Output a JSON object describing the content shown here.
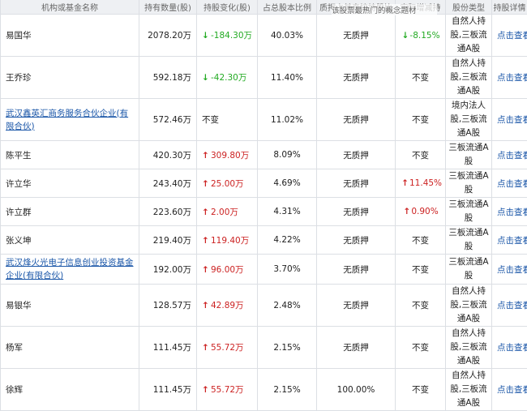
{
  "header": [
    "机构或基金名称",
    "持有数量(股)",
    "持股变化(股)",
    "占总股本比例",
    "质押占其直接持股比",
    "实际增减持",
    "股份类型",
    "持股详情"
  ],
  "tooltip": "该股票最热门的概念题材",
  "rows": [
    {
      "name": "易国华",
      "link": false,
      "qty": "2078.20万",
      "change": "-184.30万",
      "dir": "down",
      "ratio": "40.03%",
      "pledge": "无质押",
      "actual": "-8.15%",
      "actual_dir": "down",
      "type": "自然人持股,三板流通A股",
      "detail": "点击查看"
    },
    {
      "name": "王乔珍",
      "link": false,
      "qty": "592.18万",
      "change": "-42.30万",
      "dir": "down",
      "ratio": "11.40%",
      "pledge": "无质押",
      "actual": "不变",
      "actual_dir": "",
      "type": "自然人持股,三板流通A股",
      "detail": "点击查看"
    },
    {
      "name": "武汉鑫英汇商务服务合伙企业(有限合伙)",
      "link": true,
      "qty": "572.46万",
      "change": "不变",
      "dir": "",
      "ratio": "11.02%",
      "pledge": "无质押",
      "actual": "不变",
      "actual_dir": "",
      "type": "境内法人股,三板流通A股",
      "detail": "点击查看"
    },
    {
      "name": "陈平生",
      "link": false,
      "qty": "420.30万",
      "change": "309.80万",
      "dir": "up",
      "ratio": "8.09%",
      "pledge": "无质押",
      "actual": "不变",
      "actual_dir": "",
      "type": "三板流通A股",
      "detail": "点击查看"
    },
    {
      "name": "许立华",
      "link": false,
      "qty": "243.40万",
      "change": "25.00万",
      "dir": "up",
      "ratio": "4.69%",
      "pledge": "无质押",
      "actual": "11.45%",
      "actual_dir": "up",
      "type": "三板流通A股",
      "detail": "点击查看"
    },
    {
      "name": "许立群",
      "link": false,
      "qty": "223.60万",
      "change": "2.00万",
      "dir": "up",
      "ratio": "4.31%",
      "pledge": "无质押",
      "actual": "0.90%",
      "actual_dir": "up",
      "type": "三板流通A股",
      "detail": "点击查看"
    },
    {
      "name": "张义坤",
      "link": false,
      "qty": "219.40万",
      "change": "119.40万",
      "dir": "up",
      "ratio": "4.22%",
      "pledge": "无质押",
      "actual": "不变",
      "actual_dir": "",
      "type": "三板流通A股",
      "detail": "点击查看"
    },
    {
      "name": "武汉烽火光电子信息创业投资基金企业(有限合伙)",
      "link": true,
      "qty": "192.00万",
      "change": "96.00万",
      "dir": "up",
      "ratio": "3.70%",
      "pledge": "无质押",
      "actual": "不变",
      "actual_dir": "",
      "type": "三板流通A股",
      "detail": "点击查看"
    },
    {
      "name": "易银华",
      "link": false,
      "qty": "128.57万",
      "change": "42.89万",
      "dir": "up",
      "ratio": "2.48%",
      "pledge": "无质押",
      "actual": "不变",
      "actual_dir": "",
      "type": "自然人持股,三板流通A股",
      "detail": "点击查看"
    },
    {
      "name": "杨军",
      "link": false,
      "qty": "111.45万",
      "change": "55.72万",
      "dir": "up",
      "ratio": "2.15%",
      "pledge": "无质押",
      "actual": "不变",
      "actual_dir": "",
      "type": "自然人持股,三板流通A股",
      "detail": "点击查看"
    },
    {
      "name": "徐辉",
      "link": false,
      "qty": "111.45万",
      "change": "55.72万",
      "dir": "up",
      "ratio": "2.15%",
      "pledge": "100.00%",
      "actual": "不变",
      "actual_dir": "",
      "type": "自然人持股,三板流通A股",
      "detail": "点击查看"
    }
  ],
  "colors": {
    "up": "#cc2222",
    "down": "#22aa22",
    "link": "#1a56a8",
    "header_bg": "#eef0f3"
  }
}
